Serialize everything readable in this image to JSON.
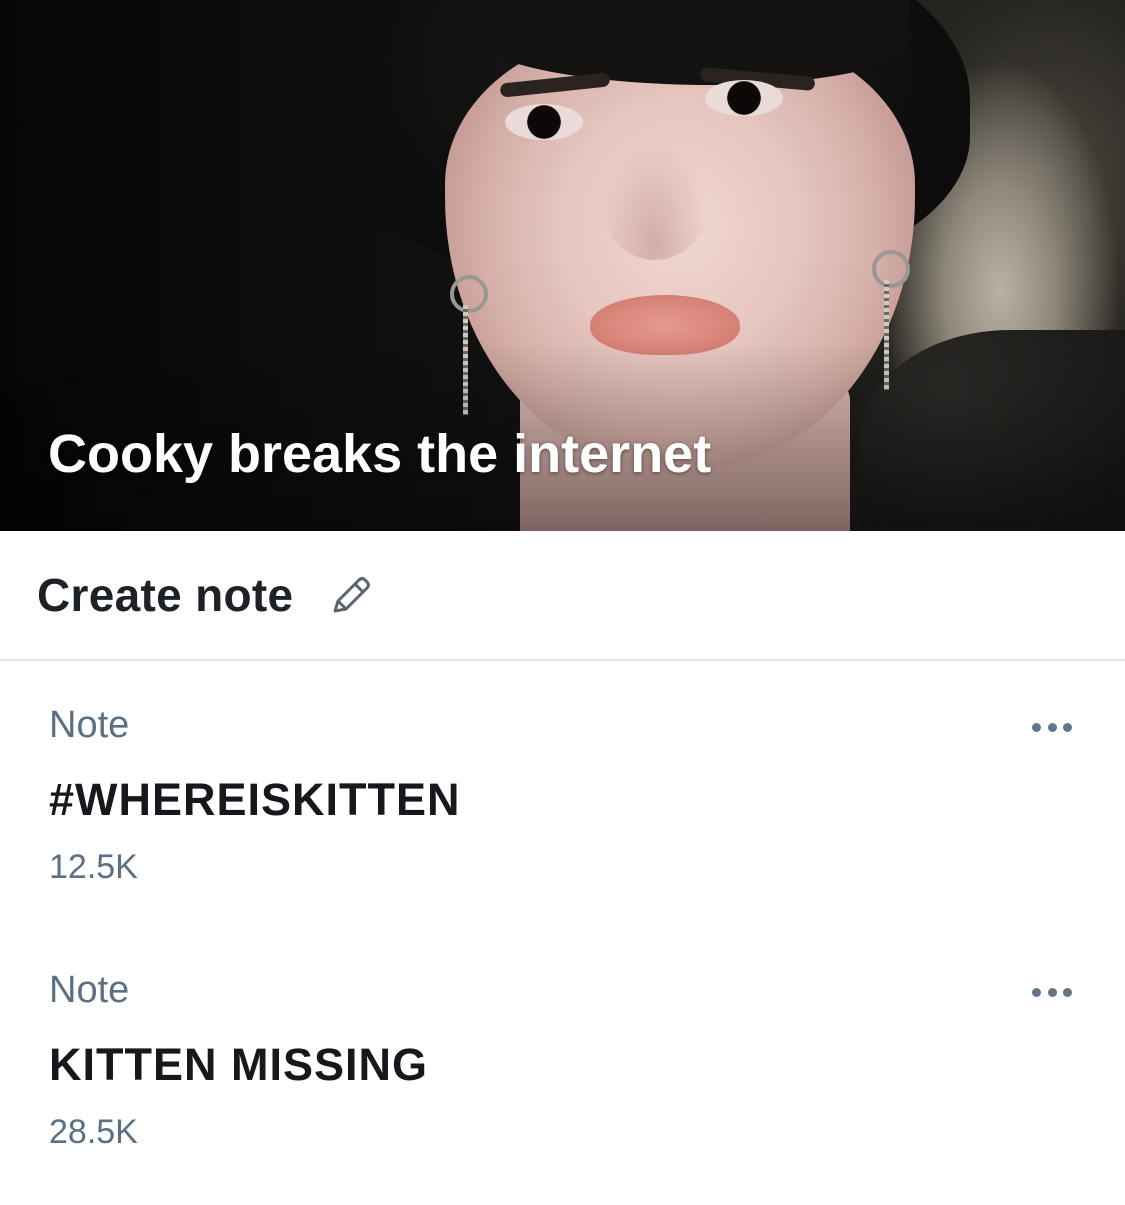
{
  "header": {
    "title": "Cooky breaks the internet",
    "photo_description_icon": "header-photo"
  },
  "create_note": {
    "label": "Create note",
    "icon": "pencil-icon"
  },
  "notes": [
    {
      "label": "Note",
      "title": "#WHEREISKITTEN",
      "count": "12.5K",
      "menu_icon": "more-options-icon"
    },
    {
      "label": "Note",
      "title": "KITTEN MISSING",
      "count": "28.5K",
      "menu_icon": "more-options-icon"
    }
  ],
  "colors": {
    "title_text": "#15191d",
    "secondary_text": "#5b7083",
    "divider": "#e3e6e9",
    "dots": "#66768a"
  }
}
